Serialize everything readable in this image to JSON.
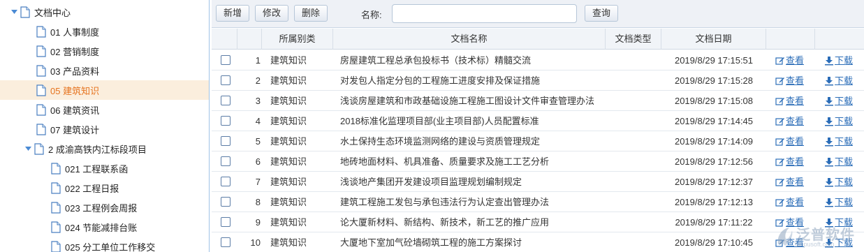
{
  "tree": {
    "root": {
      "label": "文档中心"
    },
    "items": [
      {
        "label": "01 人事制度",
        "level": 1
      },
      {
        "label": "02 营销制度",
        "level": 1
      },
      {
        "label": "03 产品资料",
        "level": 1
      },
      {
        "label": "05 建筑知识",
        "level": 1,
        "selected": true
      },
      {
        "label": "06 建筑资讯",
        "level": 1
      },
      {
        "label": "07 建筑设计",
        "level": 1
      },
      {
        "label": "2 成渝高铁内江标段项目",
        "level": 1,
        "expanded": true
      },
      {
        "label": "021 工程联系函",
        "level": 2
      },
      {
        "label": "022 工程日报",
        "level": 2
      },
      {
        "label": "023 工程例会周报",
        "level": 2
      },
      {
        "label": "024 节能减排台账",
        "level": 2
      },
      {
        "label": "025 分工单位工作移交",
        "level": 2
      }
    ]
  },
  "toolbar": {
    "add_label": "新增",
    "edit_label": "修改",
    "delete_label": "删除",
    "name_label": "名称:",
    "name_value": "",
    "query_label": "查询"
  },
  "grid": {
    "headers": {
      "category": "所属别类",
      "name": "文档名称",
      "type": "文档类型",
      "date": "文档日期"
    },
    "view_label": "查看",
    "download_label": "下载",
    "rows": [
      {
        "no": "1",
        "category": "建筑知识",
        "name": "房屋建筑工程总承包投标书（技术标）精髓交流",
        "type": "",
        "date": "2019/8/29 17:15:51"
      },
      {
        "no": "2",
        "category": "建筑知识",
        "name": "对发包人指定分包的工程施工进度安排及保证措施",
        "type": "",
        "date": "2019/8/29 17:15:28"
      },
      {
        "no": "3",
        "category": "建筑知识",
        "name": "浅谈房屋建筑和市政基础设施工程施工图设计文件审查管理办法",
        "type": "",
        "date": "2019/8/29 17:15:08"
      },
      {
        "no": "4",
        "category": "建筑知识",
        "name": "2018标准化监理项目部(业主项目部)人员配置标准",
        "type": "",
        "date": "2019/8/29 17:14:45"
      },
      {
        "no": "5",
        "category": "建筑知识",
        "name": "水土保持生态环境监测网络的建设与资质管理规定",
        "type": "",
        "date": "2019/8/29 17:14:09"
      },
      {
        "no": "6",
        "category": "建筑知识",
        "name": "地砖地面材料、机具准备、质量要求及施工工艺分析",
        "type": "",
        "date": "2019/8/29 17:12:56"
      },
      {
        "no": "7",
        "category": "建筑知识",
        "name": "浅谈地产集团开发建设项目监理规划编制规定",
        "type": "",
        "date": "2019/8/29 17:12:37"
      },
      {
        "no": "8",
        "category": "建筑知识",
        "name": "建筑工程施工发包与承包违法行为认定查出管理办法",
        "type": "",
        "date": "2019/8/29 17:12:13"
      },
      {
        "no": "9",
        "category": "建筑知识",
        "name": "论大厦新材料、新结构、新技术，新工艺的推广应用",
        "type": "",
        "date": "2019/8/29 17:11:22"
      },
      {
        "no": "10",
        "category": "建筑知识",
        "name": "大厦地下室加气砼墙砌筑工程的施工方案探讨",
        "type": "",
        "date": "2019/8/29 17:10:45"
      }
    ]
  },
  "watermark": {
    "text": "泛普软件",
    "url": "fanpusoft.com"
  },
  "colors": {
    "accent": "#e6731e",
    "link": "#2b6db8",
    "header_bg": "#f1f4f8"
  }
}
